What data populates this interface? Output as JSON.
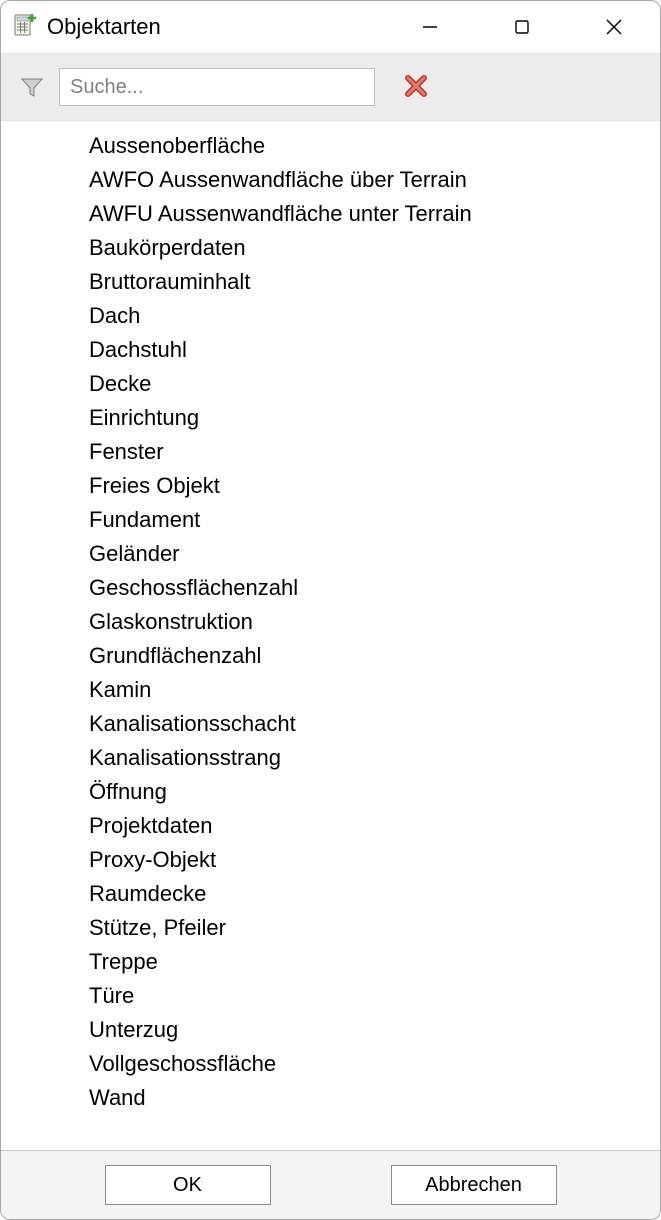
{
  "window": {
    "title": "Objektarten"
  },
  "filter": {
    "placeholder": "Suche..."
  },
  "list": {
    "items": [
      "Aussenoberfläche",
      "AWFO Aussenwandfläche über Terrain",
      "AWFU Aussenwandfläche unter Terrain",
      "Baukörperdaten",
      "Bruttorauminhalt",
      "Dach",
      "Dachstuhl",
      "Decke",
      "Einrichtung",
      "Fenster",
      "Freies Objekt",
      "Fundament",
      "Geländer",
      "Geschossflächenzahl",
      "Glaskonstruktion",
      "Grundflächenzahl",
      "Kamin",
      "Kanalisationsschacht",
      "Kanalisationsstrang",
      "Öffnung",
      "Projektdaten",
      "Proxy-Objekt",
      "Raumdecke",
      "Stütze, Pfeiler",
      "Treppe",
      "Türe",
      "Unterzug",
      "Vollgeschossfläche",
      "Wand"
    ]
  },
  "buttons": {
    "ok": "OK",
    "cancel": "Abbrechen"
  }
}
